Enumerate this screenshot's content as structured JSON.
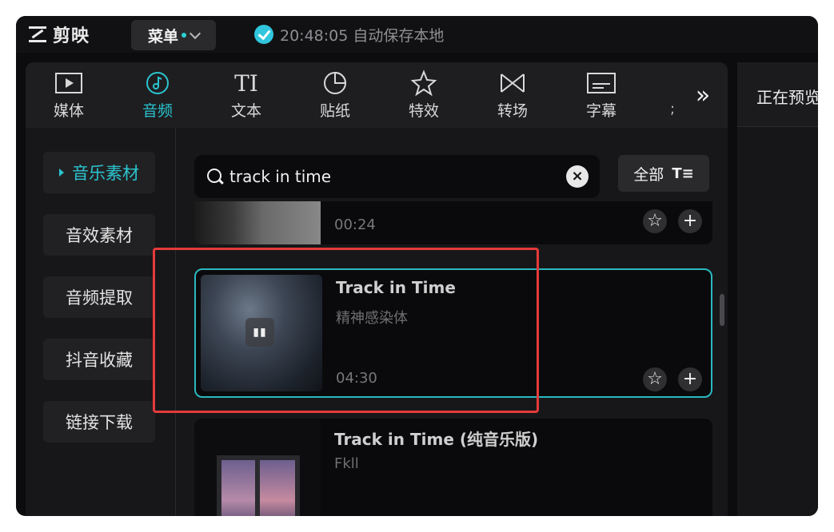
{
  "app": {
    "logo_text": "剪映",
    "menu_label": "菜单",
    "save_status": "20:48:05 自动保存本地"
  },
  "toolbar": {
    "tools": [
      {
        "label": "媒体",
        "icon": "media-icon"
      },
      {
        "label": "音频",
        "icon": "audio-icon",
        "active": true
      },
      {
        "label": "文本",
        "icon": "text-icon"
      },
      {
        "label": "贴纸",
        "icon": "sticker-icon"
      },
      {
        "label": "特效",
        "icon": "effects-icon"
      },
      {
        "label": "转场",
        "icon": "transition-icon"
      },
      {
        "label": "字幕",
        "icon": "subtitle-icon"
      }
    ],
    "more_label": "»"
  },
  "sidebar": {
    "items": [
      {
        "label": "音乐素材",
        "active": true
      },
      {
        "label": "音效素材"
      },
      {
        "label": "音频提取"
      },
      {
        "label": "抖音收藏"
      },
      {
        "label": "链接下载"
      }
    ]
  },
  "search": {
    "value": "track in time",
    "clear_label": "×"
  },
  "filter": {
    "label": "全部"
  },
  "tracks": [
    {
      "title": "",
      "artist": "",
      "duration": "00:24"
    },
    {
      "title": "Track in Time",
      "artist": "精神感染体",
      "duration": "04:30",
      "selected": true,
      "playing": true
    },
    {
      "title": "Track in Time (纯音乐版)",
      "artist": "Fkll",
      "duration": ""
    }
  ],
  "preview": {
    "title": "正在预览"
  },
  "colors": {
    "accent": "#2bc4cf",
    "highlight": "#e53a3a",
    "background": "#0c0c0e"
  }
}
